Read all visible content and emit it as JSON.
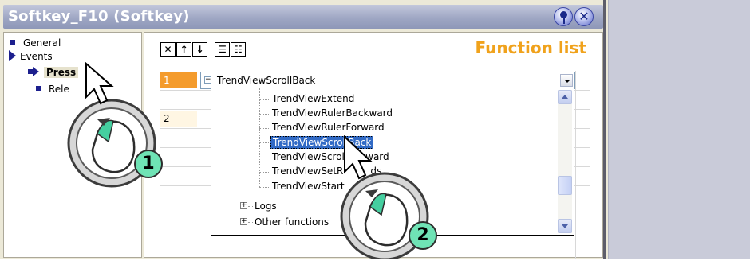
{
  "window": {
    "title": "Softkey_F10 (Softkey)",
    "pin_icon": "pin-icon",
    "close_icon": "close-icon"
  },
  "tree": {
    "items": [
      {
        "label": "General"
      },
      {
        "label": "Events"
      },
      {
        "label": "Press"
      },
      {
        "label": "Rele"
      }
    ]
  },
  "toolbar": {
    "buttons": [
      "delete-icon",
      "move-up-icon",
      "move-down-icon",
      "list-icon",
      "list-detail-icon"
    ],
    "delete_glyph": "✕",
    "up_glyph": "↑",
    "down_glyph": "↓",
    "list_glyph": "☰",
    "detail_glyph": "☷"
  },
  "function_list": {
    "title": "Function list",
    "rows": [
      {
        "number": "1",
        "function": "TrendViewScrollBack"
      },
      {
        "number": "2",
        "function": ""
      }
    ],
    "dropdown": {
      "items": [
        "TrendViewExtend",
        "TrendViewRulerBackward",
        "TrendViewRulerForward",
        "TrendViewScrollBack",
        "TrendViewScrollF",
        "TrendViewSetR",
        "TrendViewStart"
      ],
      "item_suffixes": [
        "",
        "",
        "",
        "",
        "ward",
        "ds",
        ""
      ],
      "selected": "TrendViewScrollBack",
      "groups": [
        "Logs",
        "Other functions"
      ],
      "minus_glyph": "−",
      "plus_glyph": "+"
    }
  },
  "callouts": [
    {
      "step": "1"
    },
    {
      "step": "2"
    }
  ],
  "colors": {
    "accent_orange": "#f49b2c",
    "title_text": "#f0a21c",
    "selection_blue": "#316ac5",
    "badge_green": "#6fe3b5"
  }
}
